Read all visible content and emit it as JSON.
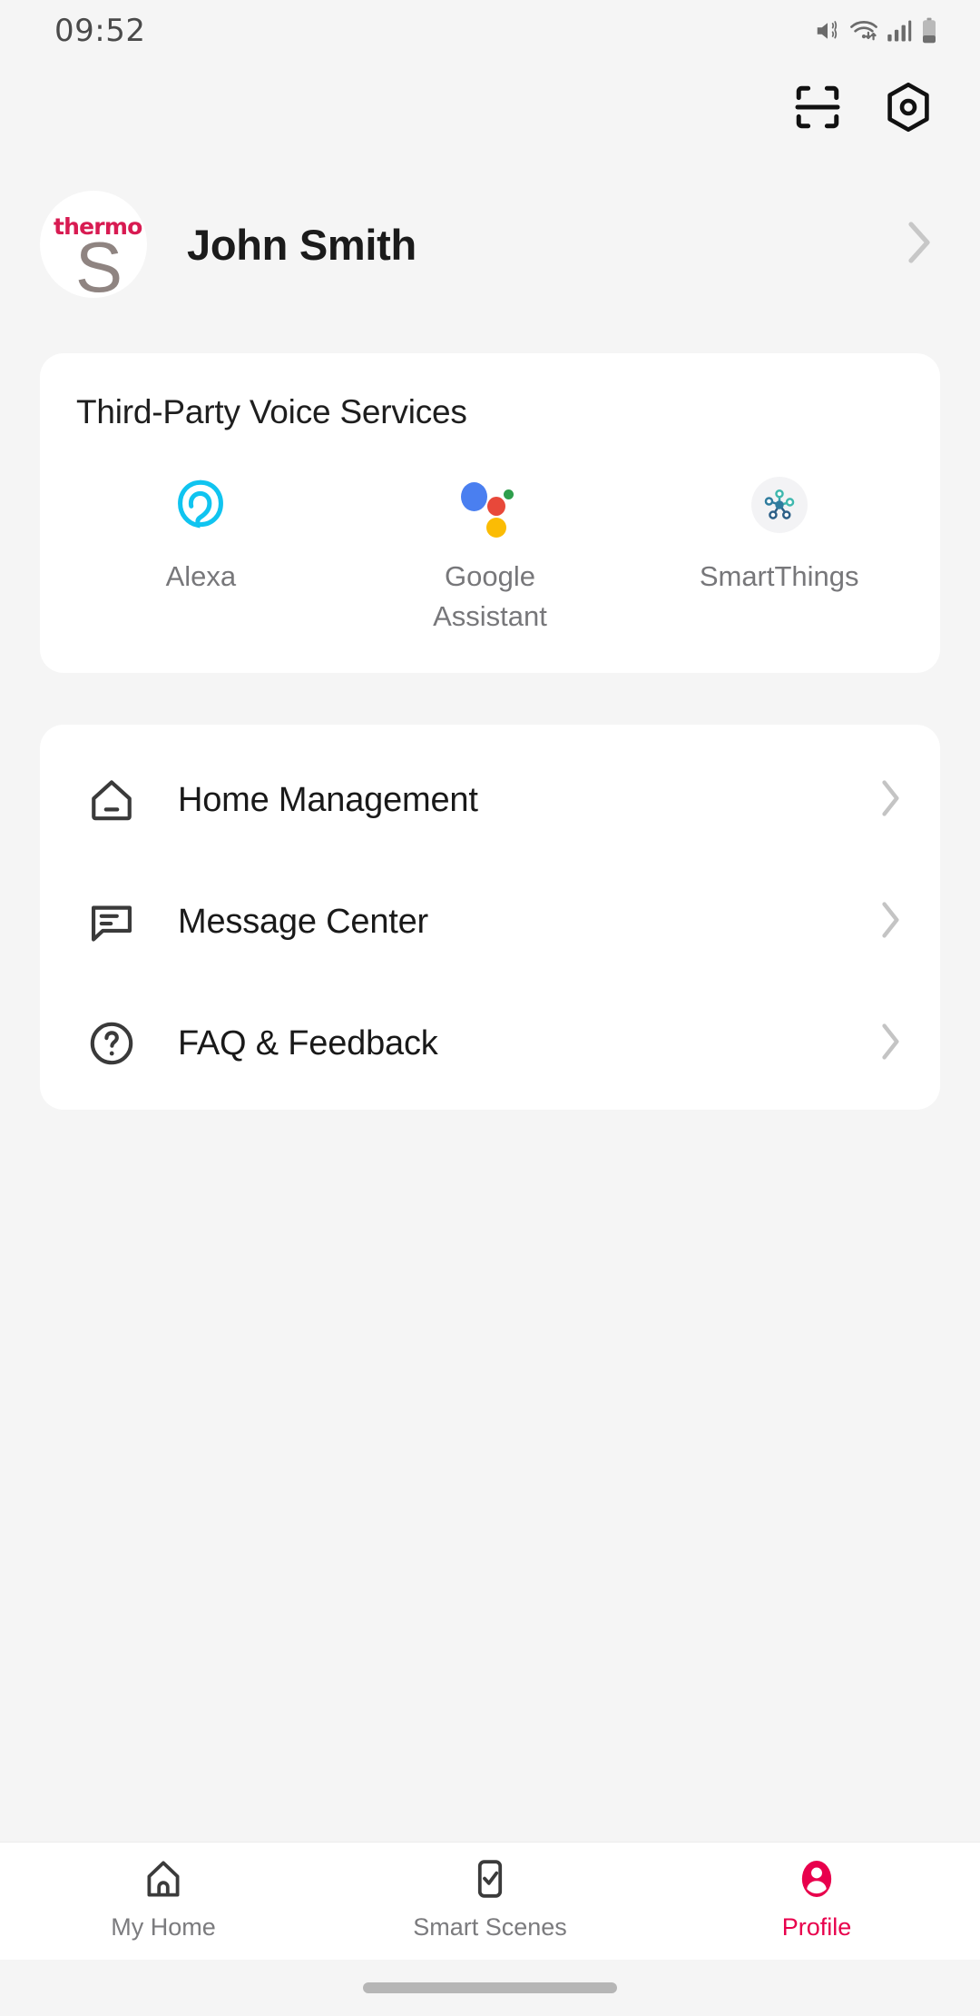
{
  "status_bar": {
    "time": "09:52",
    "icons": [
      "mute-vibrate-icon",
      "wifi-icon",
      "cellular-signal-icon",
      "battery-icon"
    ]
  },
  "action_bar": {
    "scan_label": "scan-icon",
    "settings_label": "settings-icon"
  },
  "profile": {
    "name": "John Smith",
    "avatar_brand_word": "thermo",
    "avatar_brand_mark": "S",
    "brand_color": "#d81b52",
    "mark_color": "#8f8481"
  },
  "voice_card": {
    "title": "Third-Party Voice Services",
    "services": [
      {
        "label": "Alexa",
        "icon": "alexa-icon",
        "color": "#10c4f0"
      },
      {
        "label": "Google Assistant",
        "icon": "google-assistant-icon",
        "color": "#4a7ff0"
      },
      {
        "label": "SmartThings",
        "icon": "smartthings-icon",
        "color": "#3aa6a8"
      }
    ]
  },
  "menu_card": {
    "items": [
      {
        "label": "Home Management",
        "icon": "home-icon"
      },
      {
        "label": "Message Center",
        "icon": "message-icon"
      },
      {
        "label": "FAQ & Feedback",
        "icon": "help-circle-icon"
      }
    ]
  },
  "bottom_nav": {
    "active_color": "#e8004c",
    "items": [
      {
        "label": "My Home",
        "icon": "home-outline-icon",
        "active": false
      },
      {
        "label": "Smart Scenes",
        "icon": "check-square-icon",
        "active": false
      },
      {
        "label": "Profile",
        "icon": "person-filled-icon",
        "active": true
      }
    ]
  }
}
